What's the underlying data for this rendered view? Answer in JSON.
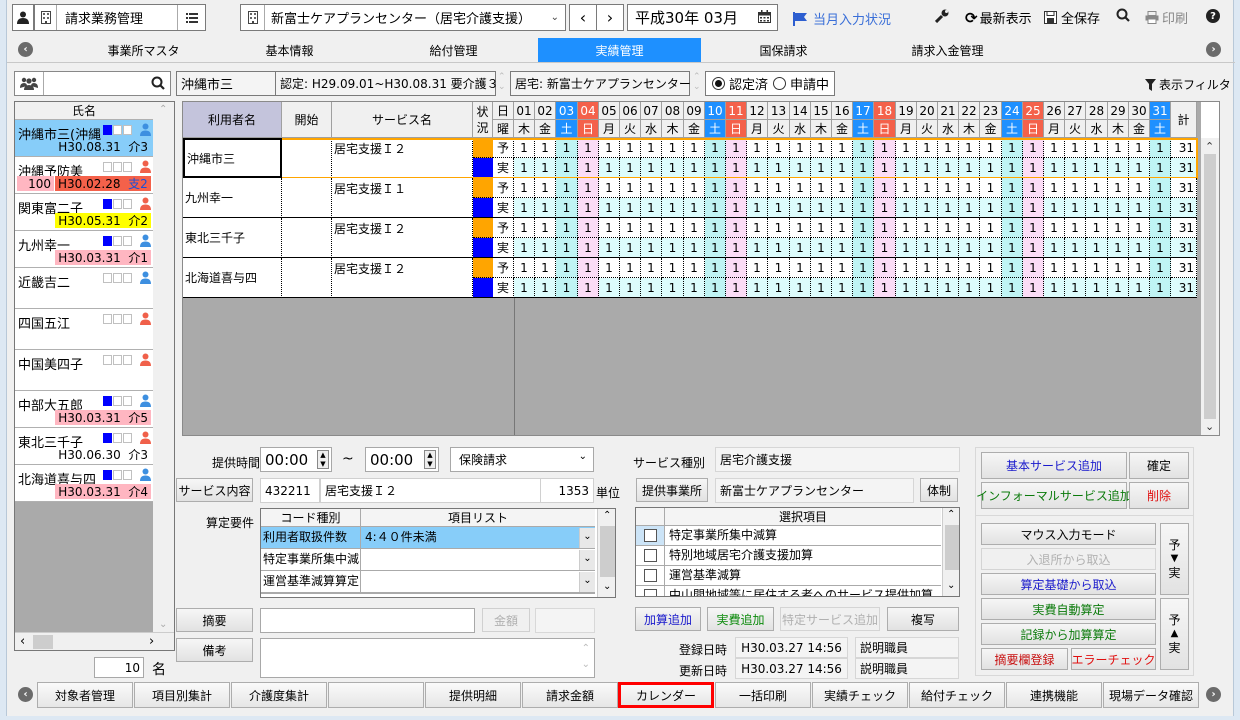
{
  "toolbar": {
    "module": "請求業務管理",
    "office": "新富士ケアプランセンター（居宅介護支援）",
    "period": "平成30年 03月",
    "month_status": "当月入力状況",
    "refresh": "最新表示",
    "save_all": "全保存",
    "print": "印刷"
  },
  "nav_tabs": [
    {
      "label": "事業所マスタ",
      "active": false
    },
    {
      "label": "基本情報",
      "active": false
    },
    {
      "label": "給付管理",
      "active": false
    },
    {
      "label": "実績管理",
      "active": true
    },
    {
      "label": "国保請求",
      "active": false
    },
    {
      "label": "請求入金管理",
      "active": false
    }
  ],
  "left": {
    "search_value": "",
    "header": "氏名",
    "count": "10",
    "count_unit": "名",
    "users": [
      {
        "name": "沖縄市三(沖縄",
        "sub": "H30.08.31  介3",
        "sub_style": "none",
        "squares": [
          true,
          false,
          false
        ],
        "gender": "male",
        "selected": true
      },
      {
        "name": "沖縄予防美",
        "sub_prefix": "100",
        "sub": "H30.02.28  ",
        "sub_extra": "支2",
        "sub_style": "red",
        "squares": [
          false,
          false,
          false
        ],
        "gender": "female"
      },
      {
        "name": "関東富二子",
        "sub": "H30.05.31  介2",
        "sub_style": "yellow",
        "squares": [
          true,
          false,
          false
        ],
        "gender": "female"
      },
      {
        "name": "九州幸一",
        "sub": "H30.03.31  介1",
        "sub_style": "pink",
        "squares": [
          true,
          false,
          false
        ],
        "gender": "male"
      },
      {
        "name": "近畿吉二",
        "sub": "",
        "sub_style": "none",
        "squares": [
          false,
          false,
          false
        ],
        "gender": "male"
      },
      {
        "name": "四国五江",
        "sub": "",
        "sub_style": "none",
        "squares": [
          false,
          false,
          false
        ],
        "gender": "female"
      },
      {
        "name": "中国美四子",
        "sub": "",
        "sub_style": "none",
        "squares": [
          false,
          false,
          false
        ],
        "gender": "female"
      },
      {
        "name": "中部大五郎",
        "sub": "H30.03.31  介5",
        "sub_style": "pink",
        "squares": [
          true,
          false,
          false
        ],
        "gender": "male"
      },
      {
        "name": "東北三千子",
        "sub": "H30.06.30  介3",
        "sub_style": "none",
        "squares": [
          true,
          false,
          false
        ],
        "gender": "female"
      },
      {
        "name": "北海道喜与四",
        "sub": "H30.03.31  介4",
        "sub_style": "pink",
        "squares": [
          true,
          false,
          false
        ],
        "gender": "male"
      }
    ]
  },
  "infobar": {
    "user": "沖縄市三",
    "certification": "認定: H29.09.01~H30.08.31 要介護３",
    "office": "居宅: 新富士ケアプランセンター",
    "radio_certified": "認定済",
    "radio_applying": "申請中",
    "radio_selected": "certified",
    "filter": "表示フィルタ"
  },
  "grid": {
    "headers": {
      "user": "利用者名",
      "start": "開始",
      "service": "サービス名",
      "status1": "状",
      "status2": "況",
      "day1": "日",
      "day2": "曜",
      "total": "計"
    },
    "days": [
      "01",
      "02",
      "03",
      "04",
      "05",
      "06",
      "07",
      "08",
      "09",
      "10",
      "11",
      "12",
      "13",
      "14",
      "15",
      "16",
      "17",
      "18",
      "19",
      "20",
      "21",
      "22",
      "23",
      "24",
      "25",
      "26",
      "27",
      "28",
      "29",
      "30",
      "31"
    ],
    "weekdays": [
      "木",
      "金",
      "土",
      "日",
      "月",
      "火",
      "水",
      "木",
      "金",
      "土",
      "日",
      "月",
      "火",
      "水",
      "木",
      "金",
      "土",
      "日",
      "月",
      "火",
      "水",
      "木",
      "金",
      "土",
      "日",
      "月",
      "火",
      "水",
      "木",
      "金",
      "土"
    ],
    "plan_label": "予",
    "actual_label": "実",
    "rows": [
      {
        "user": "沖縄市三",
        "start": "",
        "service": "居宅支援Ｉ２",
        "plan": [
          1,
          1,
          1,
          1,
          1,
          1,
          1,
          1,
          1,
          1,
          1,
          1,
          1,
          1,
          1,
          1,
          1,
          1,
          1,
          1,
          1,
          1,
          1,
          1,
          1,
          1,
          1,
          1,
          1,
          1,
          1
        ],
        "actual": [
          1,
          1,
          1,
          1,
          1,
          1,
          1,
          1,
          1,
          1,
          1,
          1,
          1,
          1,
          1,
          1,
          1,
          1,
          1,
          1,
          1,
          1,
          1,
          1,
          1,
          1,
          1,
          1,
          1,
          1,
          1
        ],
        "plan_total": "31",
        "actual_total": "31",
        "selected": true
      },
      {
        "user": "九州幸一",
        "start": "",
        "service": "居宅支援Ｉ１",
        "plan": [
          1,
          1,
          1,
          1,
          1,
          1,
          1,
          1,
          1,
          1,
          1,
          1,
          1,
          1,
          1,
          1,
          1,
          1,
          1,
          1,
          1,
          1,
          1,
          1,
          1,
          1,
          1,
          1,
          1,
          1,
          1
        ],
        "actual": [
          1,
          1,
          1,
          1,
          1,
          1,
          1,
          1,
          1,
          1,
          1,
          1,
          1,
          1,
          1,
          1,
          1,
          1,
          1,
          1,
          1,
          1,
          1,
          1,
          1,
          1,
          1,
          1,
          1,
          1,
          1
        ],
        "plan_total": "31",
        "actual_total": "31"
      },
      {
        "user": "東北三千子",
        "start": "",
        "service": "居宅支援Ｉ２",
        "plan": [
          1,
          1,
          1,
          1,
          1,
          1,
          1,
          1,
          1,
          1,
          1,
          1,
          1,
          1,
          1,
          1,
          1,
          1,
          1,
          1,
          1,
          1,
          1,
          1,
          1,
          1,
          1,
          1,
          1,
          1,
          1
        ],
        "actual": [
          1,
          1,
          1,
          1,
          1,
          1,
          1,
          1,
          1,
          1,
          1,
          1,
          1,
          1,
          1,
          1,
          1,
          1,
          1,
          1,
          1,
          1,
          1,
          1,
          1,
          1,
          1,
          1,
          1,
          1,
          1
        ],
        "plan_total": "31",
        "actual_total": "31"
      },
      {
        "user": "北海道喜与四",
        "start": "",
        "service": "居宅支援Ｉ２",
        "plan": [
          1,
          1,
          1,
          1,
          1,
          1,
          1,
          1,
          1,
          1,
          1,
          1,
          1,
          1,
          1,
          1,
          1,
          1,
          1,
          1,
          1,
          1,
          1,
          1,
          1,
          1,
          1,
          1,
          1,
          1,
          1
        ],
        "actual": [
          1,
          1,
          1,
          1,
          1,
          1,
          1,
          1,
          1,
          1,
          1,
          1,
          1,
          1,
          1,
          1,
          1,
          1,
          1,
          1,
          1,
          1,
          1,
          1,
          1,
          1,
          1,
          1,
          1,
          1,
          1
        ],
        "plan_total": "31",
        "actual_total": "31"
      }
    ]
  },
  "detail": {
    "time_label": "提供時間",
    "time_from": "00:00",
    "tilde": "~",
    "time_to": "00:00",
    "billing_type": "保険請求",
    "service_content_btn": "サービス内容",
    "service_code": "432211",
    "service_name": "居宅支援Ｉ２",
    "units": "1353",
    "units_label": "単位",
    "requirements_label": "算定要件",
    "req_headers": [
      "コード種別",
      "項目リスト"
    ],
    "req_rows": [
      {
        "code": "利用者取扱件数",
        "value": "4:４０件未満",
        "selected": true
      },
      {
        "code": "特定事業所集中減",
        "value": ""
      },
      {
        "code": "運営基準減算算定",
        "value": ""
      }
    ],
    "summary_btn": "摘要",
    "amount_btn": "金額",
    "remarks_btn": "備考",
    "service_type_label": "サービス種別",
    "service_type": "居宅介護支援",
    "provider_btn": "提供事業所",
    "provider": "新富士ケアプランセンター",
    "structure_btn": "体制",
    "select_header": "選択項目",
    "select_items": [
      "特定事業所集中減算",
      "特別地域居宅介護支援加算",
      "運営基準減算",
      "中山間地域等に居住する者へのサービス提供加算"
    ],
    "add_calc": "加算追加",
    "add_expense": "実費追加",
    "add_special": "特定サービス追加",
    "copy": "複写",
    "registered_label": "登録日時",
    "registered": "H30.03.27 14:56",
    "registered_by": "説明職員",
    "updated_label": "更新日時",
    "updated": "H30.03.27 14:56",
    "updated_by": "説明職員"
  },
  "actions": {
    "add_basic": "基本サービス追加",
    "confirm": "確定",
    "add_informal": "インフォーマルサービス追加",
    "delete": "削除",
    "mouse_mode": "マウス入力モード",
    "import_inout": "入退所から取込",
    "import_basis": "算定基礎から取込",
    "auto_expense": "実費自動算定",
    "calc_from_record": "記録から加算算定",
    "summary_register": "摘要欄登録",
    "error_check": "エラーチェック",
    "plan_to_actual": [
      "予",
      "↓",
      "実"
    ],
    "actual_to_plan": [
      "予",
      "↑",
      "実"
    ]
  },
  "bottom_tabs": [
    "対象者管理",
    "項目別集計",
    "介護度集計",
    "",
    "提供明細",
    "請求金額",
    "カレンダー",
    "一括印刷",
    "実績チェック",
    "給付チェック",
    "連携機能",
    "現場データ確認"
  ],
  "highlighted_bottom_tab": "カレンダー",
  "colors": {
    "accent": "#1e90ff",
    "saturday": "#1e90ff",
    "sunday": "#f4614a",
    "plan_status": "#ffa500",
    "actual_status": "#0000ff",
    "selected_row_border": "#ffa500",
    "highlight": "#ff0000"
  }
}
